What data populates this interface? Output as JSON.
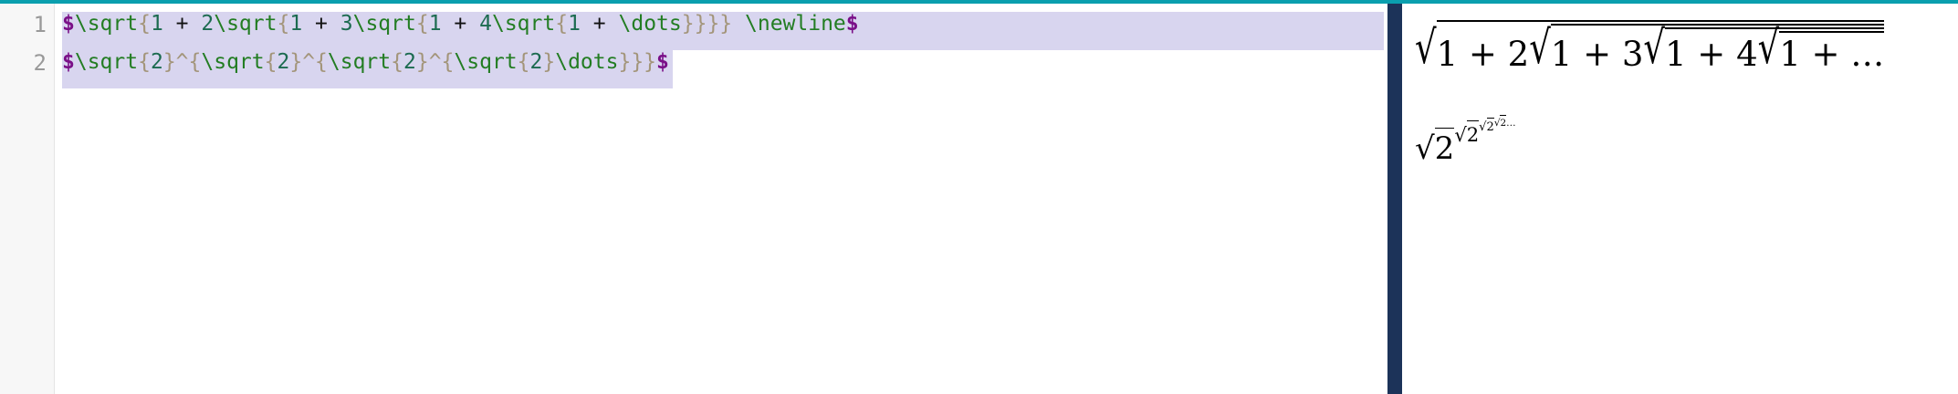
{
  "editor": {
    "line_numbers": [
      "1",
      "2"
    ],
    "lines": [
      [
        {
          "t": "$",
          "c": "dollar"
        },
        {
          "t": "\\sqrt",
          "c": "cmd"
        },
        {
          "t": "{",
          "c": "brace"
        },
        {
          "t": "1",
          "c": "num"
        },
        {
          "t": " + ",
          "c": "op"
        },
        {
          "t": "2",
          "c": "num"
        },
        {
          "t": "\\sqrt",
          "c": "cmd"
        },
        {
          "t": "{",
          "c": "brace"
        },
        {
          "t": "1",
          "c": "num"
        },
        {
          "t": " + ",
          "c": "op"
        },
        {
          "t": "3",
          "c": "num"
        },
        {
          "t": "\\sqrt",
          "c": "cmd"
        },
        {
          "t": "{",
          "c": "brace"
        },
        {
          "t": "1",
          "c": "num"
        },
        {
          "t": " + ",
          "c": "op"
        },
        {
          "t": "4",
          "c": "num"
        },
        {
          "t": "\\sqrt",
          "c": "cmd"
        },
        {
          "t": "{",
          "c": "brace"
        },
        {
          "t": "1",
          "c": "num"
        },
        {
          "t": " + ",
          "c": "op"
        },
        {
          "t": "\\dots",
          "c": "cmd"
        },
        {
          "t": "}}}}",
          "c": "brace"
        },
        {
          "t": " ",
          "c": "op"
        },
        {
          "t": "\\newline",
          "c": "cmd"
        },
        {
          "t": "$",
          "c": "dollar"
        }
      ],
      [
        {
          "t": "$",
          "c": "dollar"
        },
        {
          "t": "\\sqrt",
          "c": "cmd"
        },
        {
          "t": "{",
          "c": "brace"
        },
        {
          "t": "2",
          "c": "num"
        },
        {
          "t": "}^{",
          "c": "brace"
        },
        {
          "t": "\\sqrt",
          "c": "cmd"
        },
        {
          "t": "{",
          "c": "brace"
        },
        {
          "t": "2",
          "c": "num"
        },
        {
          "t": "}^{",
          "c": "brace"
        },
        {
          "t": "\\sqrt",
          "c": "cmd"
        },
        {
          "t": "{",
          "c": "brace"
        },
        {
          "t": "2",
          "c": "num"
        },
        {
          "t": "}^{",
          "c": "brace"
        },
        {
          "t": "\\sqrt",
          "c": "cmd"
        },
        {
          "t": "{",
          "c": "brace"
        },
        {
          "t": "2",
          "c": "num"
        },
        {
          "t": "}",
          "c": "brace"
        },
        {
          "t": "\\dots",
          "c": "cmd"
        },
        {
          "t": "}}}",
          "c": "brace"
        },
        {
          "t": "$",
          "c": "dollar"
        }
      ]
    ]
  },
  "preview": {
    "eq1": {
      "radical": "√",
      "one": "1",
      "plus": " + ",
      "two": "2",
      "three": "3",
      "four": "4",
      "dots": "…"
    },
    "eq2": {
      "radical": "√",
      "two": "2",
      "dots": "…"
    }
  },
  "colors": {
    "accent_bar": "#0a9fae",
    "divider": "#1c3359",
    "selection": "#d8d5ef",
    "dollar": "#7a1088",
    "command": "#237d23",
    "brace": "#a3957a",
    "number": "#1c6b50"
  }
}
